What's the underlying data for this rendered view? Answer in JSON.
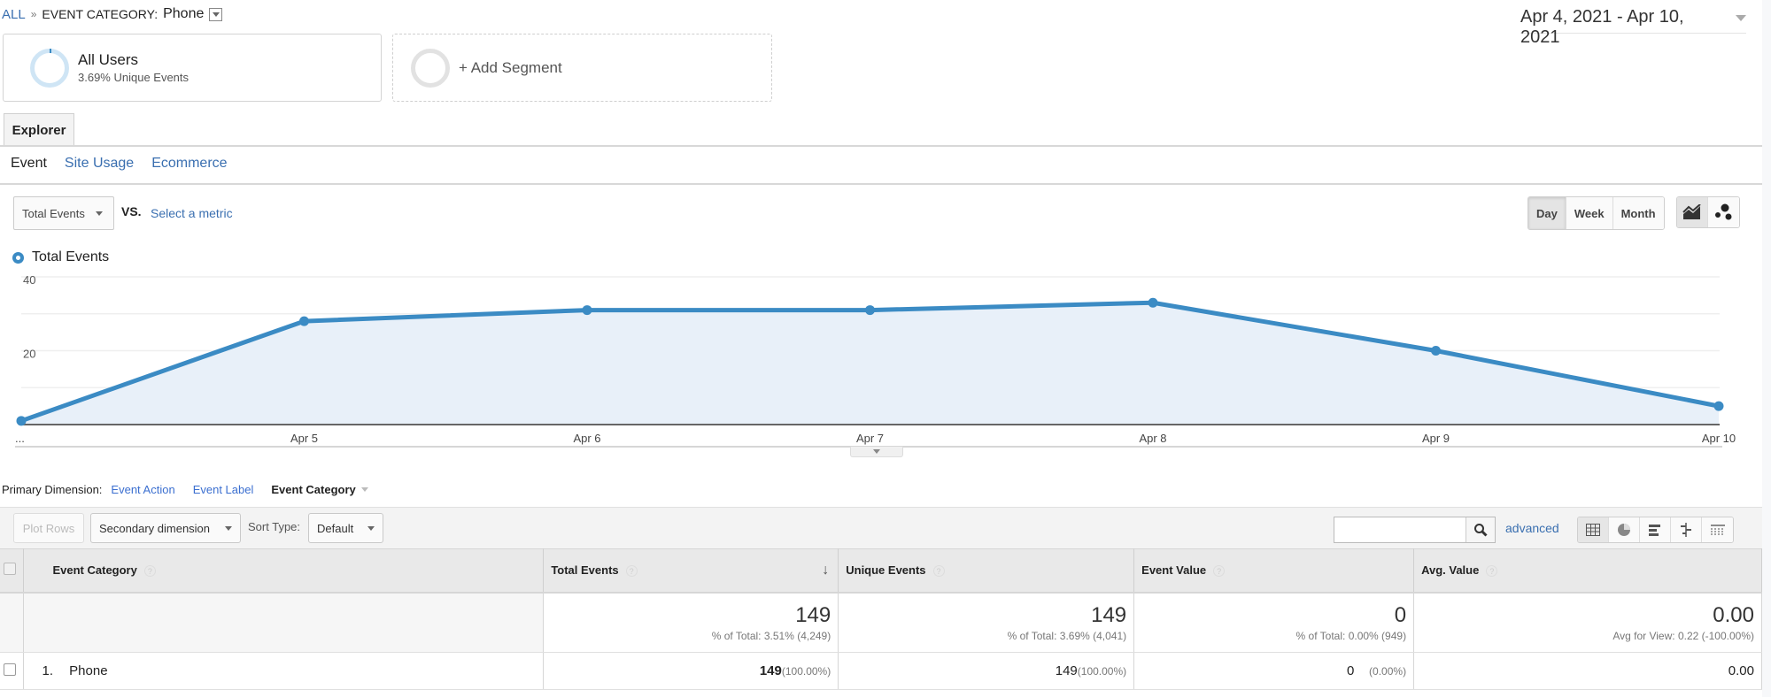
{
  "breadcrumb": {
    "root": "ALL",
    "separator": "»",
    "category_label": "EVENT CATEGORY:",
    "category_value": "Phone"
  },
  "date_range": "Apr 4, 2021 - Apr 10, 2021",
  "segments": {
    "all_users": {
      "title": "All Users",
      "subtitle": "3.69% Unique Events"
    },
    "add": {
      "label": "+ Add Segment"
    }
  },
  "explorer_tab": "Explorer",
  "subtabs": [
    {
      "label": "Event",
      "active": true
    },
    {
      "label": "Site Usage",
      "active": false
    },
    {
      "label": "Ecommerce",
      "active": false
    }
  ],
  "metric": {
    "selected": "Total Events",
    "vs_label": "VS.",
    "select_metric": "Select a metric"
  },
  "period_buttons": [
    {
      "label": "Day",
      "active": true
    },
    {
      "label": "Week",
      "active": false
    },
    {
      "label": "Month",
      "active": false
    }
  ],
  "chart_type_buttons": [
    {
      "icon": "line-chart-icon",
      "active": true
    },
    {
      "icon": "motion-chart-icon",
      "active": false
    }
  ],
  "chart_data": {
    "type": "area",
    "title": "",
    "legend": [
      "Total Events"
    ],
    "legend_position": "top-left",
    "x": [
      "...",
      "Apr 5",
      "Apr 6",
      "Apr 7",
      "Apr 8",
      "Apr 9",
      "Apr 10"
    ],
    "series": [
      {
        "name": "Total Events",
        "values": [
          1,
          28,
          31,
          31,
          33,
          20,
          5
        ],
        "color": "#3b8bc4"
      }
    ],
    "y_ticks": [
      20,
      40
    ],
    "ylim": [
      0,
      45
    ],
    "grid": true,
    "xlabel": "",
    "ylabel": ""
  },
  "primary_dimension": {
    "label": "Primary Dimension:",
    "options": [
      {
        "label": "Event Action",
        "active": false
      },
      {
        "label": "Event Label",
        "active": false
      },
      {
        "label": "Event Category",
        "active": true
      }
    ]
  },
  "toolbar": {
    "plot_rows": "Plot Rows",
    "secondary_dimension": "Secondary dimension",
    "sort_type_label": "Sort Type:",
    "sort_type_value": "Default",
    "search_value": "",
    "advanced": "advanced",
    "view_buttons": [
      "table-view-icon",
      "pie-view-icon",
      "performance-view-icon",
      "comparison-view-icon",
      "pivot-view-icon"
    ]
  },
  "table": {
    "columns": [
      {
        "label": "Event Category"
      },
      {
        "label": "Total Events",
        "sorted": "desc"
      },
      {
        "label": "Unique Events"
      },
      {
        "label": "Event Value"
      },
      {
        "label": "Avg. Value"
      }
    ],
    "summary": {
      "total_events": {
        "value": "149",
        "sub": "% of Total: 3.51% (4,249)"
      },
      "unique_events": {
        "value": "149",
        "sub": "% of Total: 3.69% (4,041)"
      },
      "event_value": {
        "value": "0",
        "sub": "% of Total: 0.00% (949)"
      },
      "avg_value": {
        "value": "0.00",
        "sub": "Avg for View: 0.22 (-100.00%)"
      }
    },
    "rows": [
      {
        "index": "1.",
        "name": "Phone",
        "total_events": "149",
        "total_events_pct": "(100.00%)",
        "unique_events": "149",
        "unique_events_pct": "(100.00%)",
        "event_value": "0",
        "event_value_pct": "(0.00%)",
        "avg_value": "0.00"
      }
    ]
  }
}
